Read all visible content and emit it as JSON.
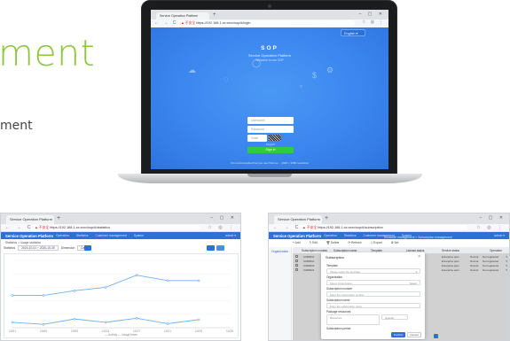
{
  "page": {
    "headline": "ment",
    "subline": "ment"
  },
  "laptop": {
    "browser": {
      "tab_title": "Service Operation Platform",
      "new_tab": "+",
      "window_controls": "– ▢ ✕",
      "nav": "← → C",
      "url_warning": "▲ 不安全",
      "url": "https://192.168.1.xx:xxxx/sop/#/login",
      "tools": "☆ ◎ ⋮"
    },
    "login": {
      "language": "English ▾",
      "logo_text": "SOP",
      "subtitle": "Service Operation Platform",
      "welcome": "Welcome to use SOP",
      "username_placeholder": "Username",
      "password_placeholder": "Password",
      "captcha_placeholder": "Code",
      "forgot": "Forgot?",
      "login_button": "Sign in",
      "footer": "It is recommended that you use Chrome ... 1920 × 1080 resolution"
    }
  },
  "chart_screen": {
    "tab_title": "Service Operation Platform",
    "url_warning": "▲ 不安全",
    "url": "https://192.168.1.xx:xxxx/sop/#/statistics",
    "brand": "Service Operation Platform",
    "menu": [
      "Operation",
      "Statistics",
      "Customer management",
      "System"
    ],
    "user": "admin ▾",
    "breadcrumb": "Statistics > Usage statistics",
    "filters": {
      "label_a": "Statistics",
      "value_a": "2020-10-01 ~ 2020-10-30",
      "label_b": "Dimension",
      "value_b": "Day"
    },
    "chart_data": {
      "type": "line",
      "title": "",
      "x": [
        "10/01",
        "10/05",
        "10/09",
        "10/13",
        "10/17",
        "10/21",
        "10/25",
        "10/29"
      ],
      "xlabel": "",
      "ylabel": "",
      "ylim": [
        0,
        100
      ],
      "series": [
        {
          "name": "",
          "values": [
            48,
            48,
            55,
            60,
            78,
            70,
            70,
            null
          ]
        },
        {
          "name": "",
          "values": [
            8,
            5,
            13,
            8,
            14,
            6,
            12,
            null
          ]
        }
      ],
      "legend": [
        "— Activity",
        "— Usage times"
      ],
      "grid": true
    }
  },
  "table_screen": {
    "tab_title": "Service Operation Platform",
    "url_warning": "▲ 不安全",
    "url": "https://192.168.1.xx:xxxx/sop/#/subscription",
    "brand": "Service Operation Platform",
    "menu": [
      "Operation",
      "Statistics",
      "Customer management",
      "System"
    ],
    "user": "admin ▾",
    "breadcrumb": "Customer management > Subscription management",
    "toolbar": [
      "+ Add",
      "✎ Edit",
      "🗑 Delete",
      "⟳ Refresh",
      "⇩ Export",
      "⚙ Set"
    ],
    "side_item": "Organization",
    "columns": [
      "Subscription number",
      "Subscription name",
      "Template",
      "License status",
      "Service status",
      "Operation"
    ],
    "rows": [
      [
        "SUB0001",
        "Enterprise plan",
        "Normal",
        "Not registered",
        "✎"
      ],
      [
        "SUB0002",
        "Enterprise plan",
        "Normal",
        "Not registered",
        "✎"
      ],
      [
        "SUB0003",
        "Enterprise plan",
        "Normal",
        "Not registered",
        "✎"
      ],
      [
        "SUB0004",
        "Enterprise plan",
        "Normal",
        "Not registered",
        "✎"
      ]
    ],
    "modal": {
      "title": "Subscription",
      "close": "×",
      "template_label": "Template",
      "template_value": "Please select the template",
      "org_label": "Organization",
      "org_value": "Select Organization",
      "org_action": "Select",
      "number_label": "Subscription number",
      "number_placeholder": "Enter the subscription number",
      "name_label": "Subscription name",
      "name_placeholder": "Enter the subscription name",
      "pkg_label": "Package resources",
      "pkg_a": "Resources",
      "pkg_b": "Quantity",
      "period_label": "Subscription period",
      "ok": "Confirm",
      "cancel": "Cancel"
    }
  }
}
